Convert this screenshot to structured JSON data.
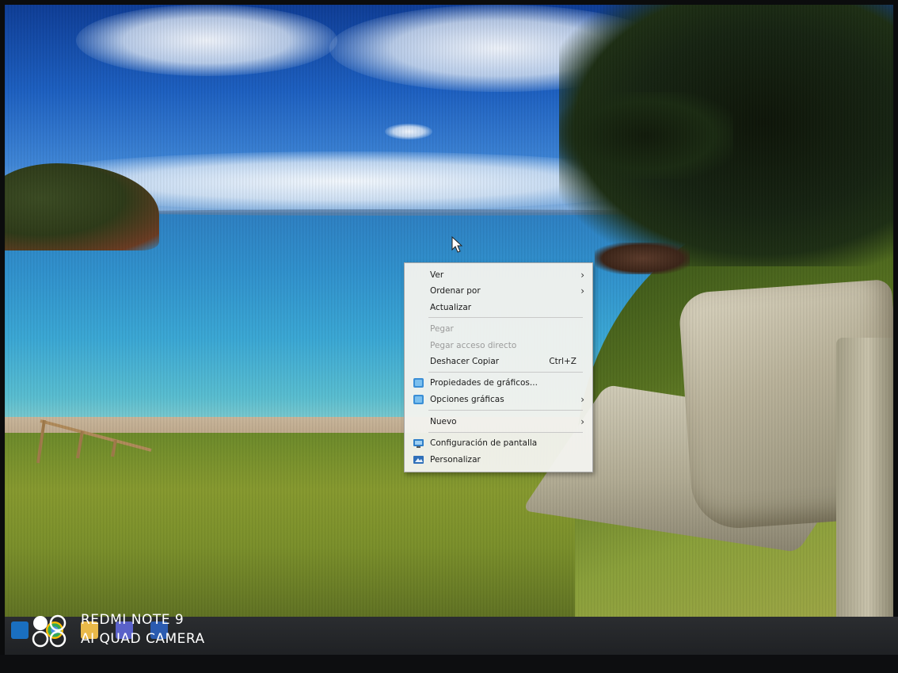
{
  "context_menu": {
    "items": [
      {
        "label": "Ver",
        "submenu": true
      },
      {
        "label": "Ordenar por",
        "submenu": true
      },
      {
        "label": "Actualizar"
      },
      {
        "label": "Pegar",
        "disabled": true
      },
      {
        "label": "Pegar acceso directo",
        "disabled": true
      },
      {
        "label": "Deshacer Copiar",
        "shortcut": "Ctrl+Z"
      },
      {
        "label": "Propiedades de gráficos...",
        "icon": "intel-graphics-icon"
      },
      {
        "label": "Opciones gráficas",
        "icon": "intel-graphics-icon",
        "submenu": true
      },
      {
        "label": "Nuevo",
        "submenu": true
      },
      {
        "label": "Configuración de pantalla",
        "icon": "display-icon"
      },
      {
        "label": "Personalizar",
        "icon": "personalize-icon"
      }
    ],
    "submenu_arrow": "›"
  },
  "taskbar": {
    "icons": [
      "outlook-icon",
      "chrome-icon",
      "folder-icon",
      "teams-icon",
      "word-icon"
    ]
  },
  "watermark": {
    "line1": "REDMI NOTE 9",
    "line2": "AI QUAD CAMERA"
  },
  "colors": {
    "menu_bg": "#f2f2ee",
    "menu_disabled": "#9b9b9b",
    "taskbar": "#232528"
  }
}
